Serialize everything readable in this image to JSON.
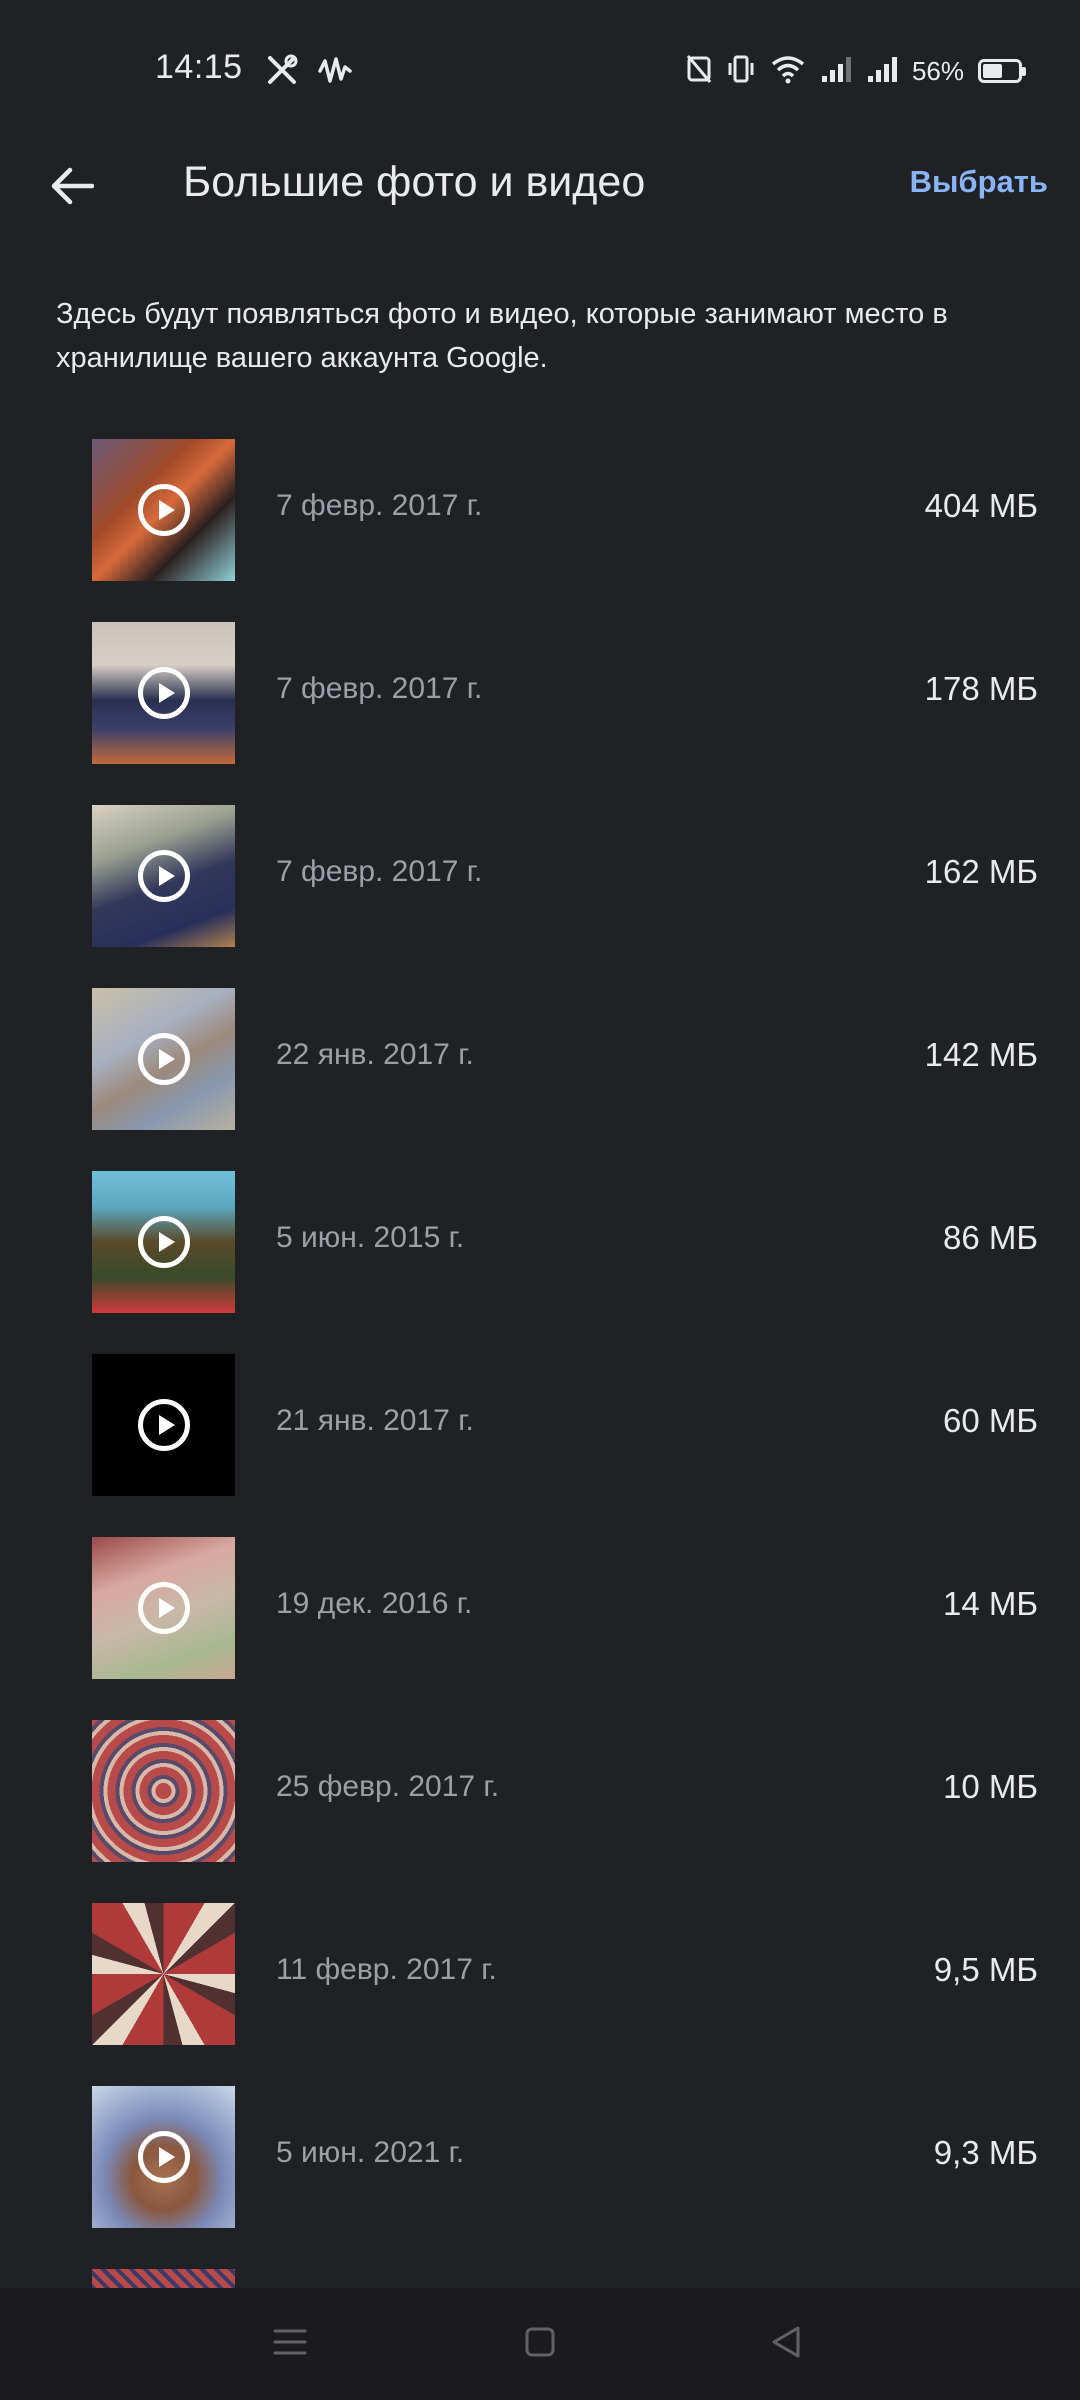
{
  "status_bar": {
    "time": "14:15",
    "battery_percent": "56%",
    "battery_level": 0.56,
    "icons": [
      "tools-icon",
      "activity-icon",
      "nfc-off-icon",
      "vibrate-icon",
      "wifi-icon",
      "signal-icon",
      "signal-icon",
      "battery-icon"
    ]
  },
  "app_bar": {
    "back_icon": "arrow-back-icon",
    "title": "Большие фото и видео",
    "select_label": "Выбрать"
  },
  "description": "Здесь будут появляться фото и видео, которые занимают место в хранилище вашего аккаунта Google.",
  "items": [
    {
      "date": "7 февр. 2017 г.",
      "size": "404 МБ",
      "video": true
    },
    {
      "date": "7 февр. 2017 г.",
      "size": "178 МБ",
      "video": true
    },
    {
      "date": "7 февр. 2017 г.",
      "size": "162 МБ",
      "video": true
    },
    {
      "date": "22 янв. 2017 г.",
      "size": "142 МБ",
      "video": true
    },
    {
      "date": "5 июн. 2015 г.",
      "size": "86 МБ",
      "video": true
    },
    {
      "date": "21 янв. 2017 г.",
      "size": "60 МБ",
      "video": true
    },
    {
      "date": "19 дек. 2016 г.",
      "size": "14 МБ",
      "video": true
    },
    {
      "date": "25 февр. 2017 г.",
      "size": "10 МБ",
      "video": false
    },
    {
      "date": "11 февр. 2017 г.",
      "size": "9,5 МБ",
      "video": false
    },
    {
      "date": "5 июн. 2021 г.",
      "size": "9,3 МБ",
      "video": true
    }
  ],
  "nav_bar": {
    "icons": [
      "menu-icon",
      "home-icon",
      "back-triangle-icon"
    ]
  },
  "colors": {
    "background": "#202124",
    "accent": "#8ab4f8",
    "secondary_text": "#9aa0a6"
  }
}
